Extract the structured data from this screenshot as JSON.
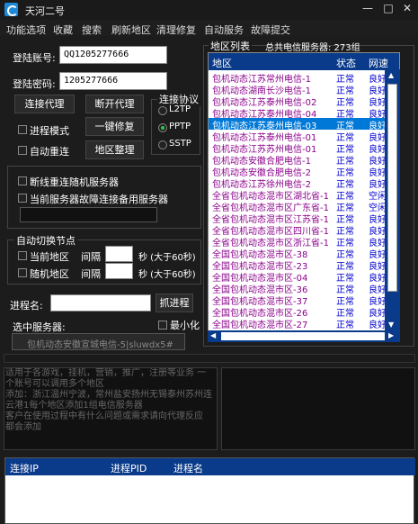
{
  "app": {
    "title": "天河二号"
  },
  "window_controls": {
    "minimize": "—",
    "maximize": "□",
    "close": "✕"
  },
  "menu": [
    "功能选项",
    "收藏",
    "搜索",
    "刷新地区",
    "清理修复",
    "自动服务",
    "故障提交"
  ],
  "login": {
    "account_label": "登陆账号:",
    "account_value": "QQ1205277666",
    "password_label": "登陆密码:",
    "password_value": "1205277666"
  },
  "buttons": {
    "connect": "连接代理",
    "disconnect": "断开代理",
    "repair": "一键修复",
    "region": "地区整理",
    "grab": "抓进程"
  },
  "checkboxes": {
    "process_mode": "进程模式",
    "auto_reconnect": "自动重连",
    "drop_random": "断线重连随机服务器",
    "fault_backup": "当前服务器故障连接备用服务器",
    "current_region": "当前地区",
    "random_region": "随机地区",
    "minimize": "最小化"
  },
  "protocol": {
    "label": "连接协议",
    "options": [
      "L2TP",
      "PPTP",
      "SSTP"
    ],
    "selected": "PPTP"
  },
  "auto_switch": {
    "label": "自动切换节点",
    "interval": "间隔",
    "unit": "秒 (大于60秒)"
  },
  "process": {
    "label": "进程名:",
    "selected_label": "选中服务器:",
    "selected_value": "包机动态安徽宣城电信-5|sluwdx5#"
  },
  "region_list": {
    "group_label": "地区列表",
    "total": "总共电信服务器: 273组",
    "headers": [
      "地区",
      "状态",
      "网速"
    ],
    "rows": [
      [
        "包机动态江苏常州电信-1",
        "正常",
        "良好"
      ],
      [
        "包机动态湖南长沙电信-1",
        "正常",
        "良好"
      ],
      [
        "包机动态江苏泰州电信-02",
        "正常",
        "良好"
      ],
      [
        "包机动态江苏泰州电信-04",
        "正常",
        "良好"
      ],
      [
        "包机动态江苏泰州电信-03",
        "正常",
        "良好"
      ],
      [
        "包机动态江苏泰州电信-01",
        "正常",
        "良好"
      ],
      [
        "包机动态江苏苏州电信-01",
        "正常",
        "良好"
      ],
      [
        "包机动态安徽合肥电信-1",
        "正常",
        "良好"
      ],
      [
        "包机动态安徽合肥电信-2",
        "正常",
        "良好"
      ],
      [
        "包机动态江苏徐州电信-2",
        "正常",
        "良好"
      ],
      [
        "全省包机动态混市区湖北省-1",
        "正常",
        "空闲"
      ],
      [
        "全省包机动态混市区广东省-1",
        "正常",
        "空闲"
      ],
      [
        "全省包机动态混市区江苏省-1",
        "正常",
        "良好"
      ],
      [
        "全省包机动态混市区四川省-1",
        "正常",
        "良好"
      ],
      [
        "全省包机动态混市区浙江省-1",
        "正常",
        "良好"
      ],
      [
        "全国包机动态混市区-38",
        "正常",
        "良好"
      ],
      [
        "全国包机动态混市区-23",
        "正常",
        "良好"
      ],
      [
        "全国包机动态混市区-04",
        "正常",
        "良好"
      ],
      [
        "全国包机动态混市区-36",
        "正常",
        "良好"
      ],
      [
        "全国包机动态混市区-37",
        "正常",
        "良好"
      ],
      [
        "全国包机动态混市区-26",
        "正常",
        "良好"
      ],
      [
        "全国包机动态混市区-27",
        "正常",
        "良好"
      ]
    ],
    "selected_index": 4
  },
  "log_text": [
    "适用于各游戏，挂机，营销，推广，注册等业务 一",
    "个账号可以调用多个地区",
    "添加：浙江温州宁波，常州盐安扬州无锡泰州苏州连",
    "云港1每个地区添加1组电信服务器",
    "客户在使用过程中有什么问题或需求请向代理反应",
    "都会添加"
  ],
  "process_table": {
    "headers": [
      "连接IP",
      "进程PID",
      "进程名"
    ]
  },
  "colors": {
    "header_blue": "#0a3a8a",
    "region_text": "#8b008b",
    "status_text": "#0000cc"
  }
}
